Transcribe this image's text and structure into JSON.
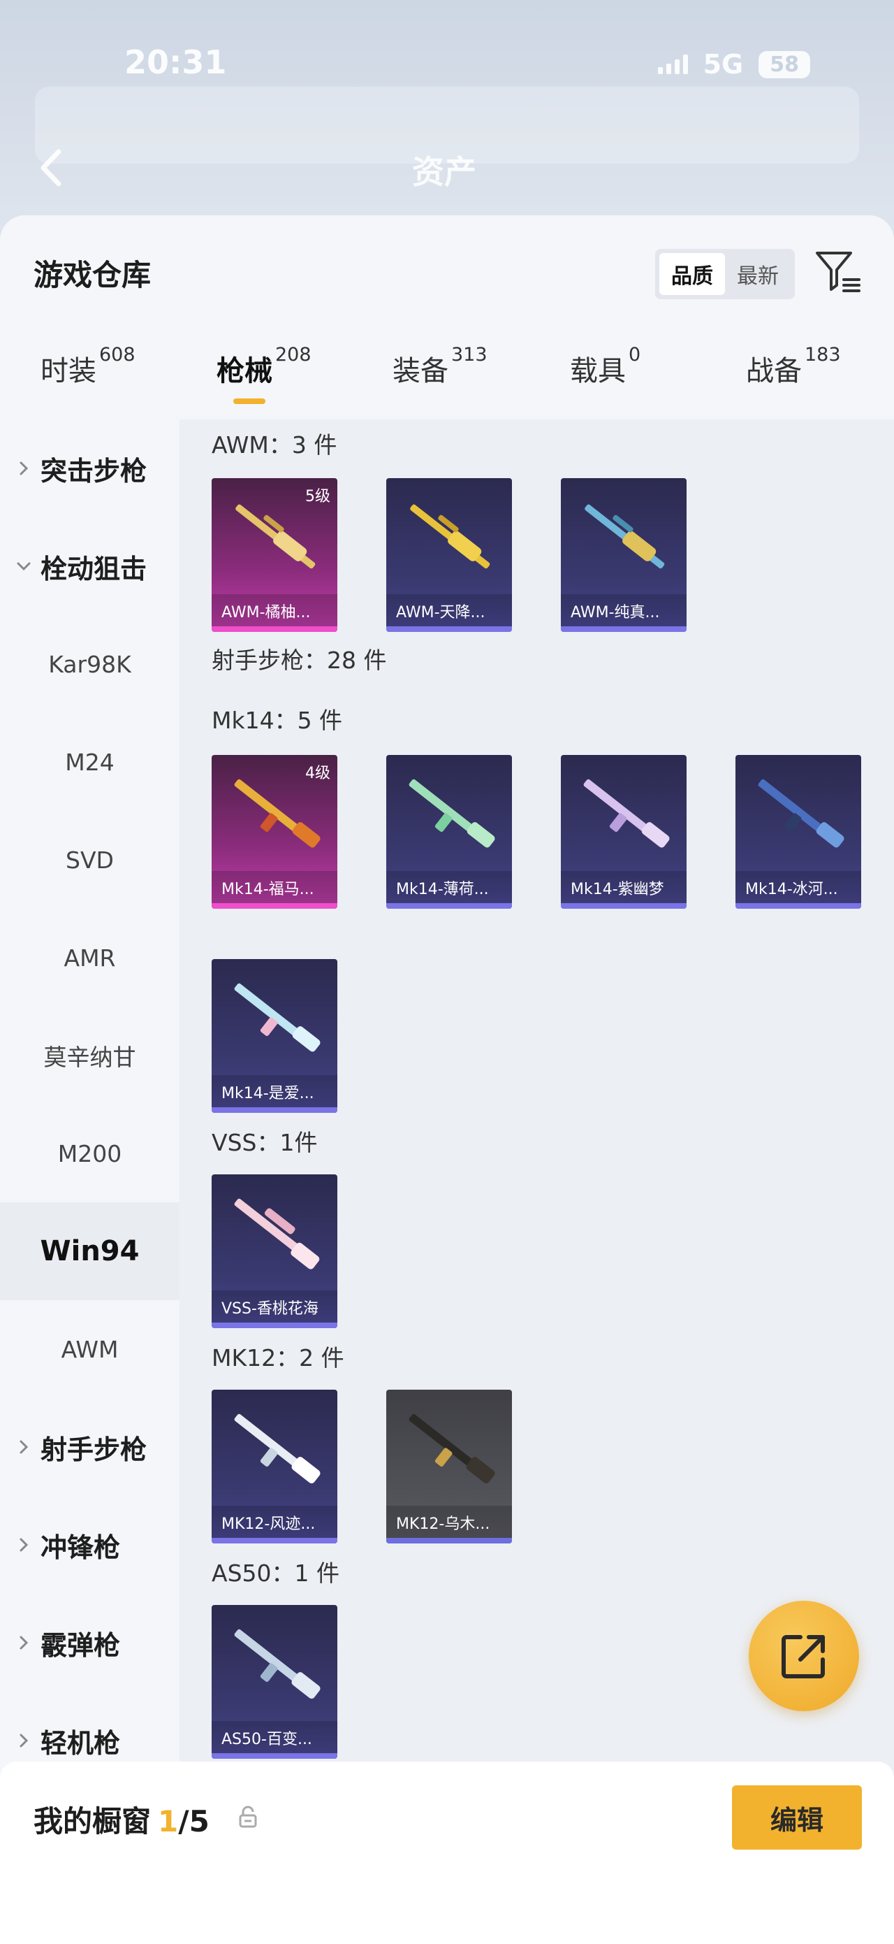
{
  "status": {
    "time": "20:31",
    "network": "5G",
    "battery": "58"
  },
  "nav": {
    "title": "资产"
  },
  "sheet": {
    "title": "游戏仓库"
  },
  "sort": {
    "options": [
      "品质",
      "最新"
    ],
    "active": "品质"
  },
  "tabs": [
    {
      "label": "时装",
      "count": "608"
    },
    {
      "label": "枪械",
      "count": "208"
    },
    {
      "label": "装备",
      "count": "313"
    },
    {
      "label": "载具",
      "count": "0"
    },
    {
      "label": "战备",
      "count": "183"
    }
  ],
  "active_tab": "枪械",
  "categories": [
    {
      "label": "突击步枪",
      "kind": "category",
      "expanded": false
    },
    {
      "label": "栓动狙击",
      "kind": "category",
      "expanded": true
    },
    {
      "label": "Kar98K",
      "kind": "sub"
    },
    {
      "label": "M24",
      "kind": "sub"
    },
    {
      "label": "SVD",
      "kind": "sub"
    },
    {
      "label": "AMR",
      "kind": "sub"
    },
    {
      "label": "莫辛纳甘",
      "kind": "sub"
    },
    {
      "label": "M200",
      "kind": "sub"
    },
    {
      "label": "Win94",
      "kind": "sub",
      "selected": true
    },
    {
      "label": "AWM",
      "kind": "sub"
    },
    {
      "label": "射手步枪",
      "kind": "category",
      "expanded": false
    },
    {
      "label": "冲锋枪",
      "kind": "category",
      "expanded": false
    },
    {
      "label": "霰弹枪",
      "kind": "category",
      "expanded": false
    },
    {
      "label": "轻机枪",
      "kind": "category",
      "expanded": false
    }
  ],
  "groups": {
    "awm": {
      "title": "AWM：3 件",
      "items": [
        {
          "label": "AWM-橘柚...",
          "level": "5级",
          "rarity": "pink"
        },
        {
          "label": "AWM-天降...",
          "rarity": "purple"
        },
        {
          "label": "AWM-纯真...",
          "rarity": "purple"
        }
      ]
    },
    "marksman": {
      "title": "射手步枪：28 件"
    },
    "mk14": {
      "title": "Mk14：5 件",
      "items": [
        {
          "label": "Mk14-福马...",
          "level": "4级",
          "rarity": "pink"
        },
        {
          "label": "Mk14-薄荷...",
          "rarity": "purple"
        },
        {
          "label": "Mk14-紫幽梦",
          "rarity": "purple"
        },
        {
          "label": "Mk14-冰河...",
          "rarity": "purple"
        },
        {
          "label": "Mk14-是爱...",
          "rarity": "purple"
        }
      ]
    },
    "vss": {
      "title": "VSS：1件",
      "items": [
        {
          "label": "VSS-香桃花海",
          "rarity": "purple"
        }
      ]
    },
    "mk12": {
      "title": "MK12：2 件",
      "items": [
        {
          "label": "MK12-风迹...",
          "rarity": "purple"
        },
        {
          "label": "MK12-乌木...",
          "rarity": "gray"
        }
      ]
    },
    "as50": {
      "title": "AS50：1 件",
      "items": [
        {
          "label": "AS50-百变...",
          "rarity": "purple"
        }
      ]
    }
  },
  "showcase": {
    "title": "我的橱窗",
    "current": "1",
    "total": "/5",
    "edit_label": "编辑"
  },
  "colors": {
    "accent": "#f2b22e",
    "purple_card": "#3b3a72",
    "pink_card": "#8b2c7c"
  },
  "icons": [
    "back-arrow-icon",
    "filter-icon",
    "chevron-right-icon",
    "chevron-down-icon",
    "lock-icon",
    "share-icon",
    "rifle-icon"
  ]
}
